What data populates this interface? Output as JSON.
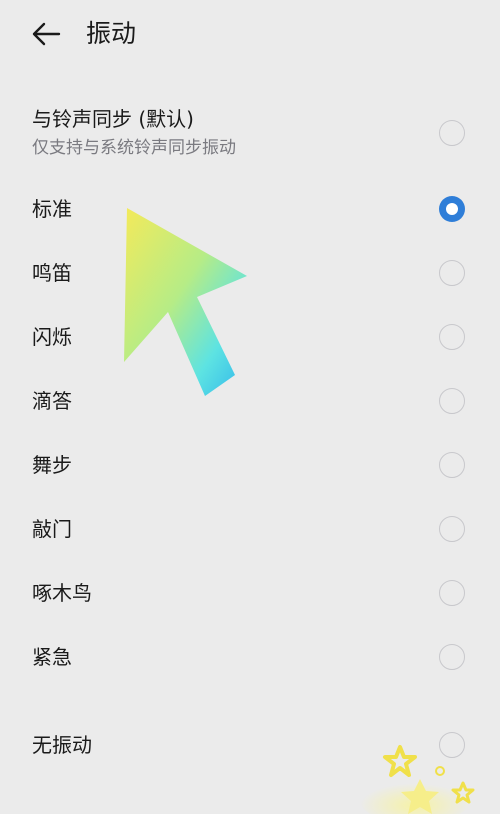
{
  "header": {
    "title": "振动"
  },
  "options": [
    {
      "label": "与铃声同步 (默认)",
      "subtitle": "仅支持与系统铃声同步振动",
      "selected": false
    },
    {
      "label": "标准",
      "selected": true
    },
    {
      "label": "鸣笛",
      "selected": false
    },
    {
      "label": "闪烁",
      "selected": false
    },
    {
      "label": "滴答",
      "selected": false
    },
    {
      "label": "舞步",
      "selected": false
    },
    {
      "label": "敲门",
      "selected": false
    },
    {
      "label": "啄木鸟",
      "selected": false
    },
    {
      "label": "紧急",
      "selected": false
    },
    {
      "label": "无振动",
      "selected": false
    }
  ],
  "colors": {
    "background": "#ebebeb",
    "accent": "#2f7ed8",
    "radio_border": "#c8c8cc",
    "subtitle": "#7a7a80"
  },
  "icons": {
    "back": "back-arrow-icon",
    "pointer": "cursor-arrow-icon",
    "stars": "stars-icon"
  }
}
